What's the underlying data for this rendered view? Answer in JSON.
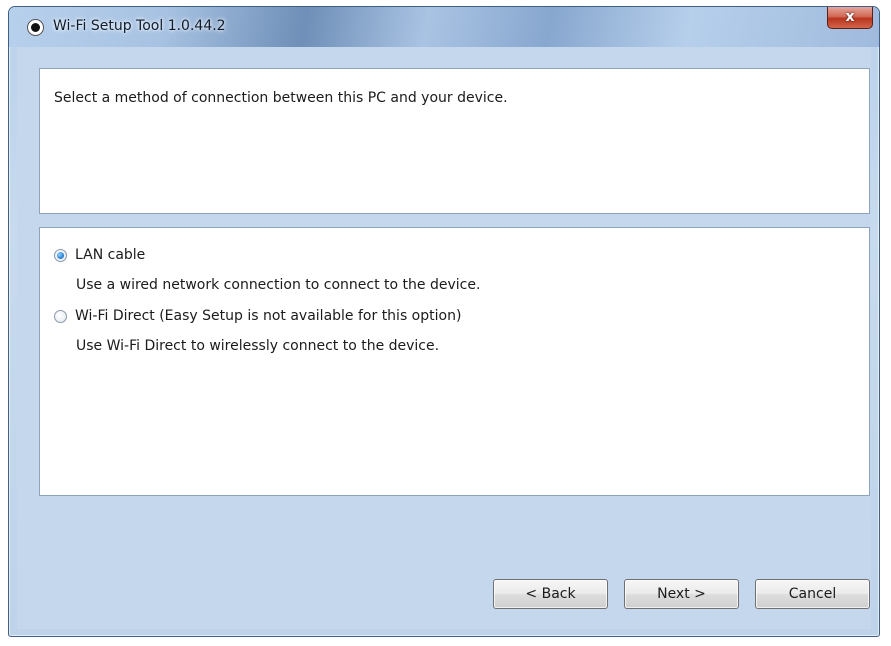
{
  "window": {
    "title": "Wi-Fi Setup Tool 1.0.44.2",
    "close_glyph": "x"
  },
  "header": {
    "instruction": "Select a method of connection between this PC and your device."
  },
  "options": [
    {
      "label": "LAN cable",
      "description": "Use a wired network connection to connect to the device.",
      "selected": true
    },
    {
      "label": "Wi-Fi Direct (Easy Setup is not available for this option)",
      "description": "Use Wi-Fi Direct to wirelessly connect to the device.",
      "selected": false
    }
  ],
  "buttons": {
    "back": "< Back",
    "next": "Next >",
    "cancel": "Cancel"
  },
  "colors": {
    "window_background": "#c4d7ec",
    "panel_background": "#ffffff",
    "close_button": "#c9452d",
    "radio_selected": "#2f86d6"
  }
}
